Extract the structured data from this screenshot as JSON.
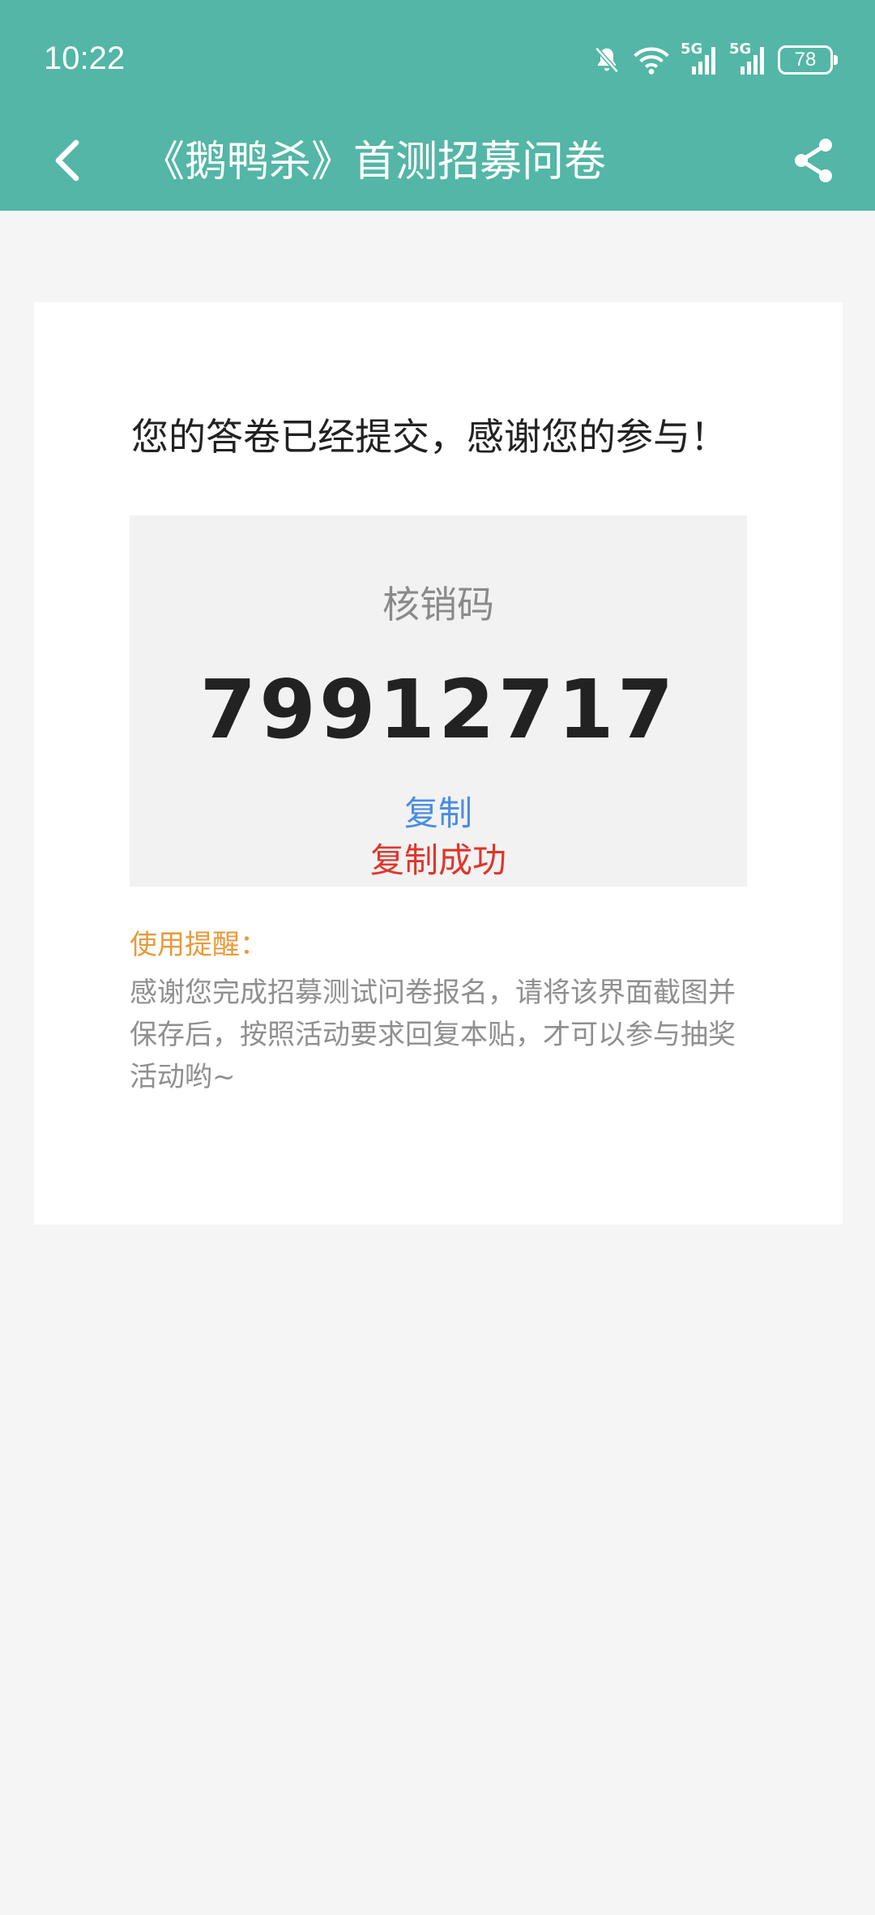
{
  "status_bar": {
    "time": "10:22",
    "signal_1": "5G",
    "signal_2": "5G",
    "battery": "78",
    "icons": [
      "bell-off-icon",
      "wifi-icon",
      "signal-5g-icon",
      "signal-5g-icon",
      "battery-icon"
    ]
  },
  "header": {
    "title": "《鹅鸭杀》首测招募问卷",
    "back_icon": "back-chevron-icon",
    "share_icon": "share-icon"
  },
  "result": {
    "message": "您的答卷已经提交，感谢您的参与！",
    "code_label": "核销码",
    "code_value": "79912717",
    "copy_label": "复制",
    "copy_success": "复制成功"
  },
  "reminder": {
    "title": "使用提醒：",
    "text": "感谢您完成招募测试问卷报名，请将该界面截图并保存后，按照活动要求回复本贴，才可以参与抽奖活动哟~"
  },
  "colors": {
    "header_bg": "#53b6a6",
    "page_bg": "#f5f5f5",
    "copy_link": "#4a8de0",
    "copy_success": "#e0352b",
    "reminder_title": "#e89a3c"
  }
}
